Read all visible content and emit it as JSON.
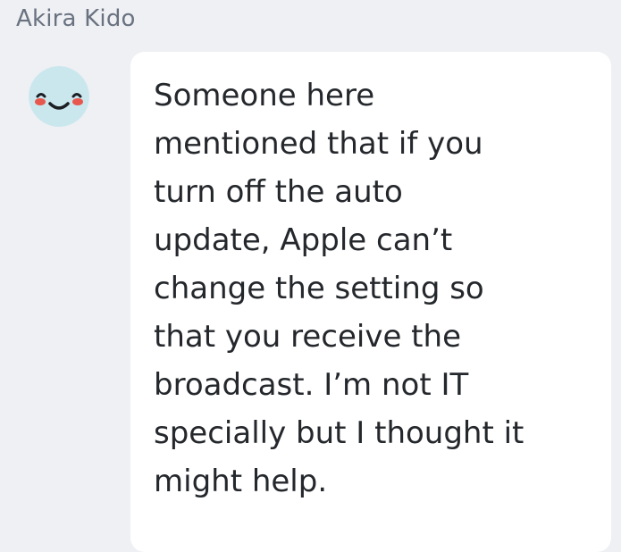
{
  "message": {
    "sender_name": "Akira Kido",
    "avatar_icon": "smiling-face-icon",
    "text": "Someone here\nmentioned that if you\nturn off the auto\nupdate, Apple can’t\nchange the setting so\nthat you receive the\nbroadcast. I’m not IT\nspecially but I thought it\nmight help."
  },
  "colors": {
    "background": "#eef0f4",
    "bubble": "#ffffff",
    "avatar_background": "#cbe7ee",
    "avatar_cheeks": "#e8574d",
    "sender_name": "#6a7280",
    "text": "#24272b"
  }
}
